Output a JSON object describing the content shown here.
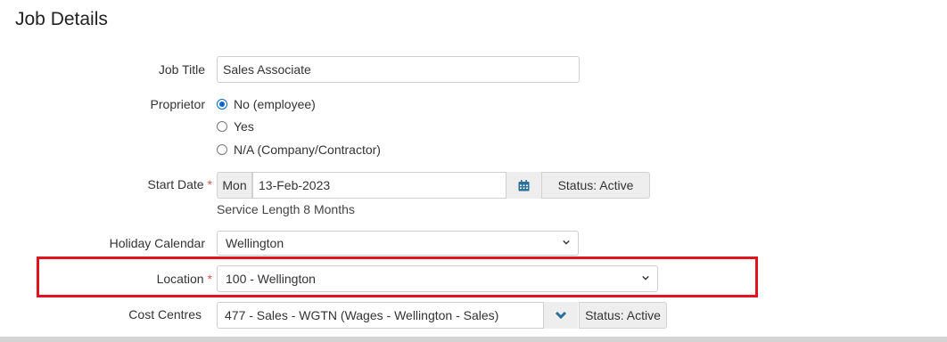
{
  "page": {
    "title": "Job Details"
  },
  "job_title": {
    "label": "Job Title",
    "value": "Sales Associate"
  },
  "proprietor": {
    "label": "Proprietor",
    "options": [
      {
        "label": "No (employee)",
        "checked": true
      },
      {
        "label": "Yes",
        "checked": false
      },
      {
        "label": "N/A (Company/Contractor)",
        "checked": false
      }
    ]
  },
  "start_date": {
    "label": "Start Date",
    "required_mark": "*",
    "day": "Mon",
    "value": "13-Feb-2023",
    "calendar_icon": "calendar-icon",
    "status": "Status: Active",
    "service_length": "Service Length 8 Months"
  },
  "holiday_calendar": {
    "label": "Holiday Calendar",
    "value": "Wellington"
  },
  "location": {
    "label": "Location",
    "required_mark": "*",
    "value": "100 - Wellington"
  },
  "cost_centres": {
    "label": "Cost Centres",
    "value": "477 - Sales - WGTN (Wages - Wellington - Sales)",
    "status": "Status: Active"
  },
  "colors": {
    "highlight": "#e0141e",
    "required": "#d9534f",
    "icon": "#2a6f97",
    "radio": "#0a66c2"
  }
}
